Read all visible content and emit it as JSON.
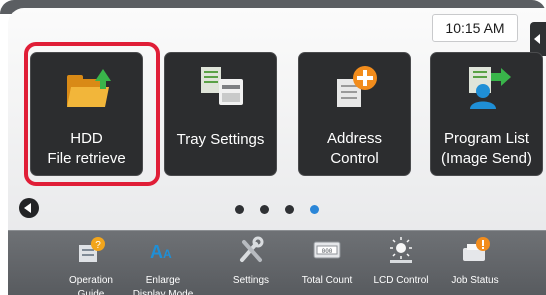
{
  "status": {
    "time": "10:15 AM"
  },
  "tiles": [
    {
      "label": "HDD\nFile retrieve"
    },
    {
      "label": "Tray Settings"
    },
    {
      "label": "Address\nControl"
    },
    {
      "label": "Program List\n(Image Send)"
    }
  ],
  "pager": {
    "total": 4,
    "current": 4
  },
  "taskbar": [
    {
      "label": "Operation\nGuide",
      "icon": "operation-guide-icon"
    },
    {
      "label": "Enlarge\nDisplay Mode",
      "icon": "enlarge-display-icon"
    },
    {
      "label": "Settings",
      "icon": "settings-icon"
    },
    {
      "label": "Total Count",
      "icon": "total-count-icon"
    },
    {
      "label": "LCD Control",
      "icon": "lcd-control-icon"
    },
    {
      "label": "Job Status",
      "icon": "job-status-icon"
    }
  ],
  "colors": {
    "highlight": "#e01e37",
    "active_dot": "#2a86d8",
    "tile": "#2c2d2f"
  }
}
